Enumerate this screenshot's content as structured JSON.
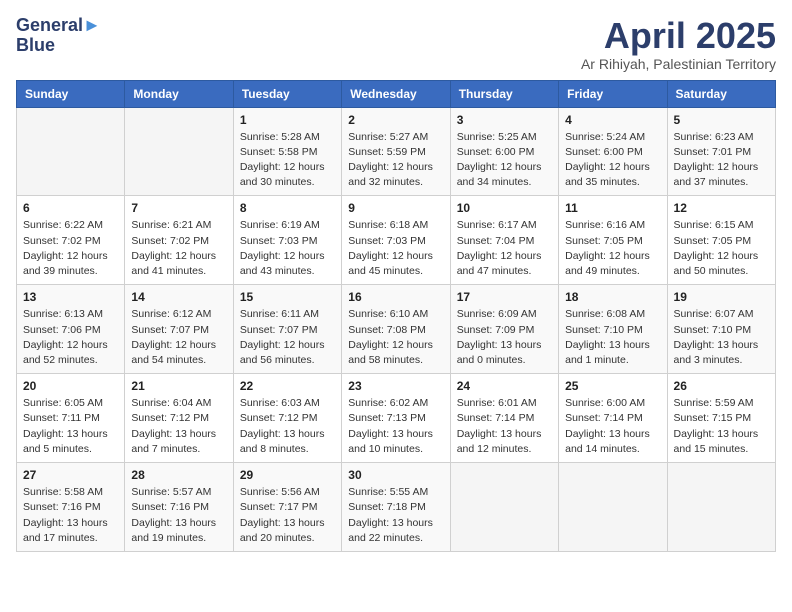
{
  "header": {
    "logo_line1": "General",
    "logo_line2": "Blue",
    "month_title": "April 2025",
    "subtitle": "Ar Rihiyah, Palestinian Territory"
  },
  "days_of_week": [
    "Sunday",
    "Monday",
    "Tuesday",
    "Wednesday",
    "Thursday",
    "Friday",
    "Saturday"
  ],
  "weeks": [
    [
      {
        "day": "",
        "info": ""
      },
      {
        "day": "",
        "info": ""
      },
      {
        "day": "1",
        "info": "Sunrise: 5:28 AM\nSunset: 5:58 PM\nDaylight: 12 hours\nand 30 minutes."
      },
      {
        "day": "2",
        "info": "Sunrise: 5:27 AM\nSunset: 5:59 PM\nDaylight: 12 hours\nand 32 minutes."
      },
      {
        "day": "3",
        "info": "Sunrise: 5:25 AM\nSunset: 6:00 PM\nDaylight: 12 hours\nand 34 minutes."
      },
      {
        "day": "4",
        "info": "Sunrise: 5:24 AM\nSunset: 6:00 PM\nDaylight: 12 hours\nand 35 minutes."
      },
      {
        "day": "5",
        "info": "Sunrise: 6:23 AM\nSunset: 7:01 PM\nDaylight: 12 hours\nand 37 minutes."
      }
    ],
    [
      {
        "day": "6",
        "info": "Sunrise: 6:22 AM\nSunset: 7:02 PM\nDaylight: 12 hours\nand 39 minutes."
      },
      {
        "day": "7",
        "info": "Sunrise: 6:21 AM\nSunset: 7:02 PM\nDaylight: 12 hours\nand 41 minutes."
      },
      {
        "day": "8",
        "info": "Sunrise: 6:19 AM\nSunset: 7:03 PM\nDaylight: 12 hours\nand 43 minutes."
      },
      {
        "day": "9",
        "info": "Sunrise: 6:18 AM\nSunset: 7:03 PM\nDaylight: 12 hours\nand 45 minutes."
      },
      {
        "day": "10",
        "info": "Sunrise: 6:17 AM\nSunset: 7:04 PM\nDaylight: 12 hours\nand 47 minutes."
      },
      {
        "day": "11",
        "info": "Sunrise: 6:16 AM\nSunset: 7:05 PM\nDaylight: 12 hours\nand 49 minutes."
      },
      {
        "day": "12",
        "info": "Sunrise: 6:15 AM\nSunset: 7:05 PM\nDaylight: 12 hours\nand 50 minutes."
      }
    ],
    [
      {
        "day": "13",
        "info": "Sunrise: 6:13 AM\nSunset: 7:06 PM\nDaylight: 12 hours\nand 52 minutes."
      },
      {
        "day": "14",
        "info": "Sunrise: 6:12 AM\nSunset: 7:07 PM\nDaylight: 12 hours\nand 54 minutes."
      },
      {
        "day": "15",
        "info": "Sunrise: 6:11 AM\nSunset: 7:07 PM\nDaylight: 12 hours\nand 56 minutes."
      },
      {
        "day": "16",
        "info": "Sunrise: 6:10 AM\nSunset: 7:08 PM\nDaylight: 12 hours\nand 58 minutes."
      },
      {
        "day": "17",
        "info": "Sunrise: 6:09 AM\nSunset: 7:09 PM\nDaylight: 13 hours\nand 0 minutes."
      },
      {
        "day": "18",
        "info": "Sunrise: 6:08 AM\nSunset: 7:10 PM\nDaylight: 13 hours\nand 1 minute."
      },
      {
        "day": "19",
        "info": "Sunrise: 6:07 AM\nSunset: 7:10 PM\nDaylight: 13 hours\nand 3 minutes."
      }
    ],
    [
      {
        "day": "20",
        "info": "Sunrise: 6:05 AM\nSunset: 7:11 PM\nDaylight: 13 hours\nand 5 minutes."
      },
      {
        "day": "21",
        "info": "Sunrise: 6:04 AM\nSunset: 7:12 PM\nDaylight: 13 hours\nand 7 minutes."
      },
      {
        "day": "22",
        "info": "Sunrise: 6:03 AM\nSunset: 7:12 PM\nDaylight: 13 hours\nand 8 minutes."
      },
      {
        "day": "23",
        "info": "Sunrise: 6:02 AM\nSunset: 7:13 PM\nDaylight: 13 hours\nand 10 minutes."
      },
      {
        "day": "24",
        "info": "Sunrise: 6:01 AM\nSunset: 7:14 PM\nDaylight: 13 hours\nand 12 minutes."
      },
      {
        "day": "25",
        "info": "Sunrise: 6:00 AM\nSunset: 7:14 PM\nDaylight: 13 hours\nand 14 minutes."
      },
      {
        "day": "26",
        "info": "Sunrise: 5:59 AM\nSunset: 7:15 PM\nDaylight: 13 hours\nand 15 minutes."
      }
    ],
    [
      {
        "day": "27",
        "info": "Sunrise: 5:58 AM\nSunset: 7:16 PM\nDaylight: 13 hours\nand 17 minutes."
      },
      {
        "day": "28",
        "info": "Sunrise: 5:57 AM\nSunset: 7:16 PM\nDaylight: 13 hours\nand 19 minutes."
      },
      {
        "day": "29",
        "info": "Sunrise: 5:56 AM\nSunset: 7:17 PM\nDaylight: 13 hours\nand 20 minutes."
      },
      {
        "day": "30",
        "info": "Sunrise: 5:55 AM\nSunset: 7:18 PM\nDaylight: 13 hours\nand 22 minutes."
      },
      {
        "day": "",
        "info": ""
      },
      {
        "day": "",
        "info": ""
      },
      {
        "day": "",
        "info": ""
      }
    ]
  ]
}
